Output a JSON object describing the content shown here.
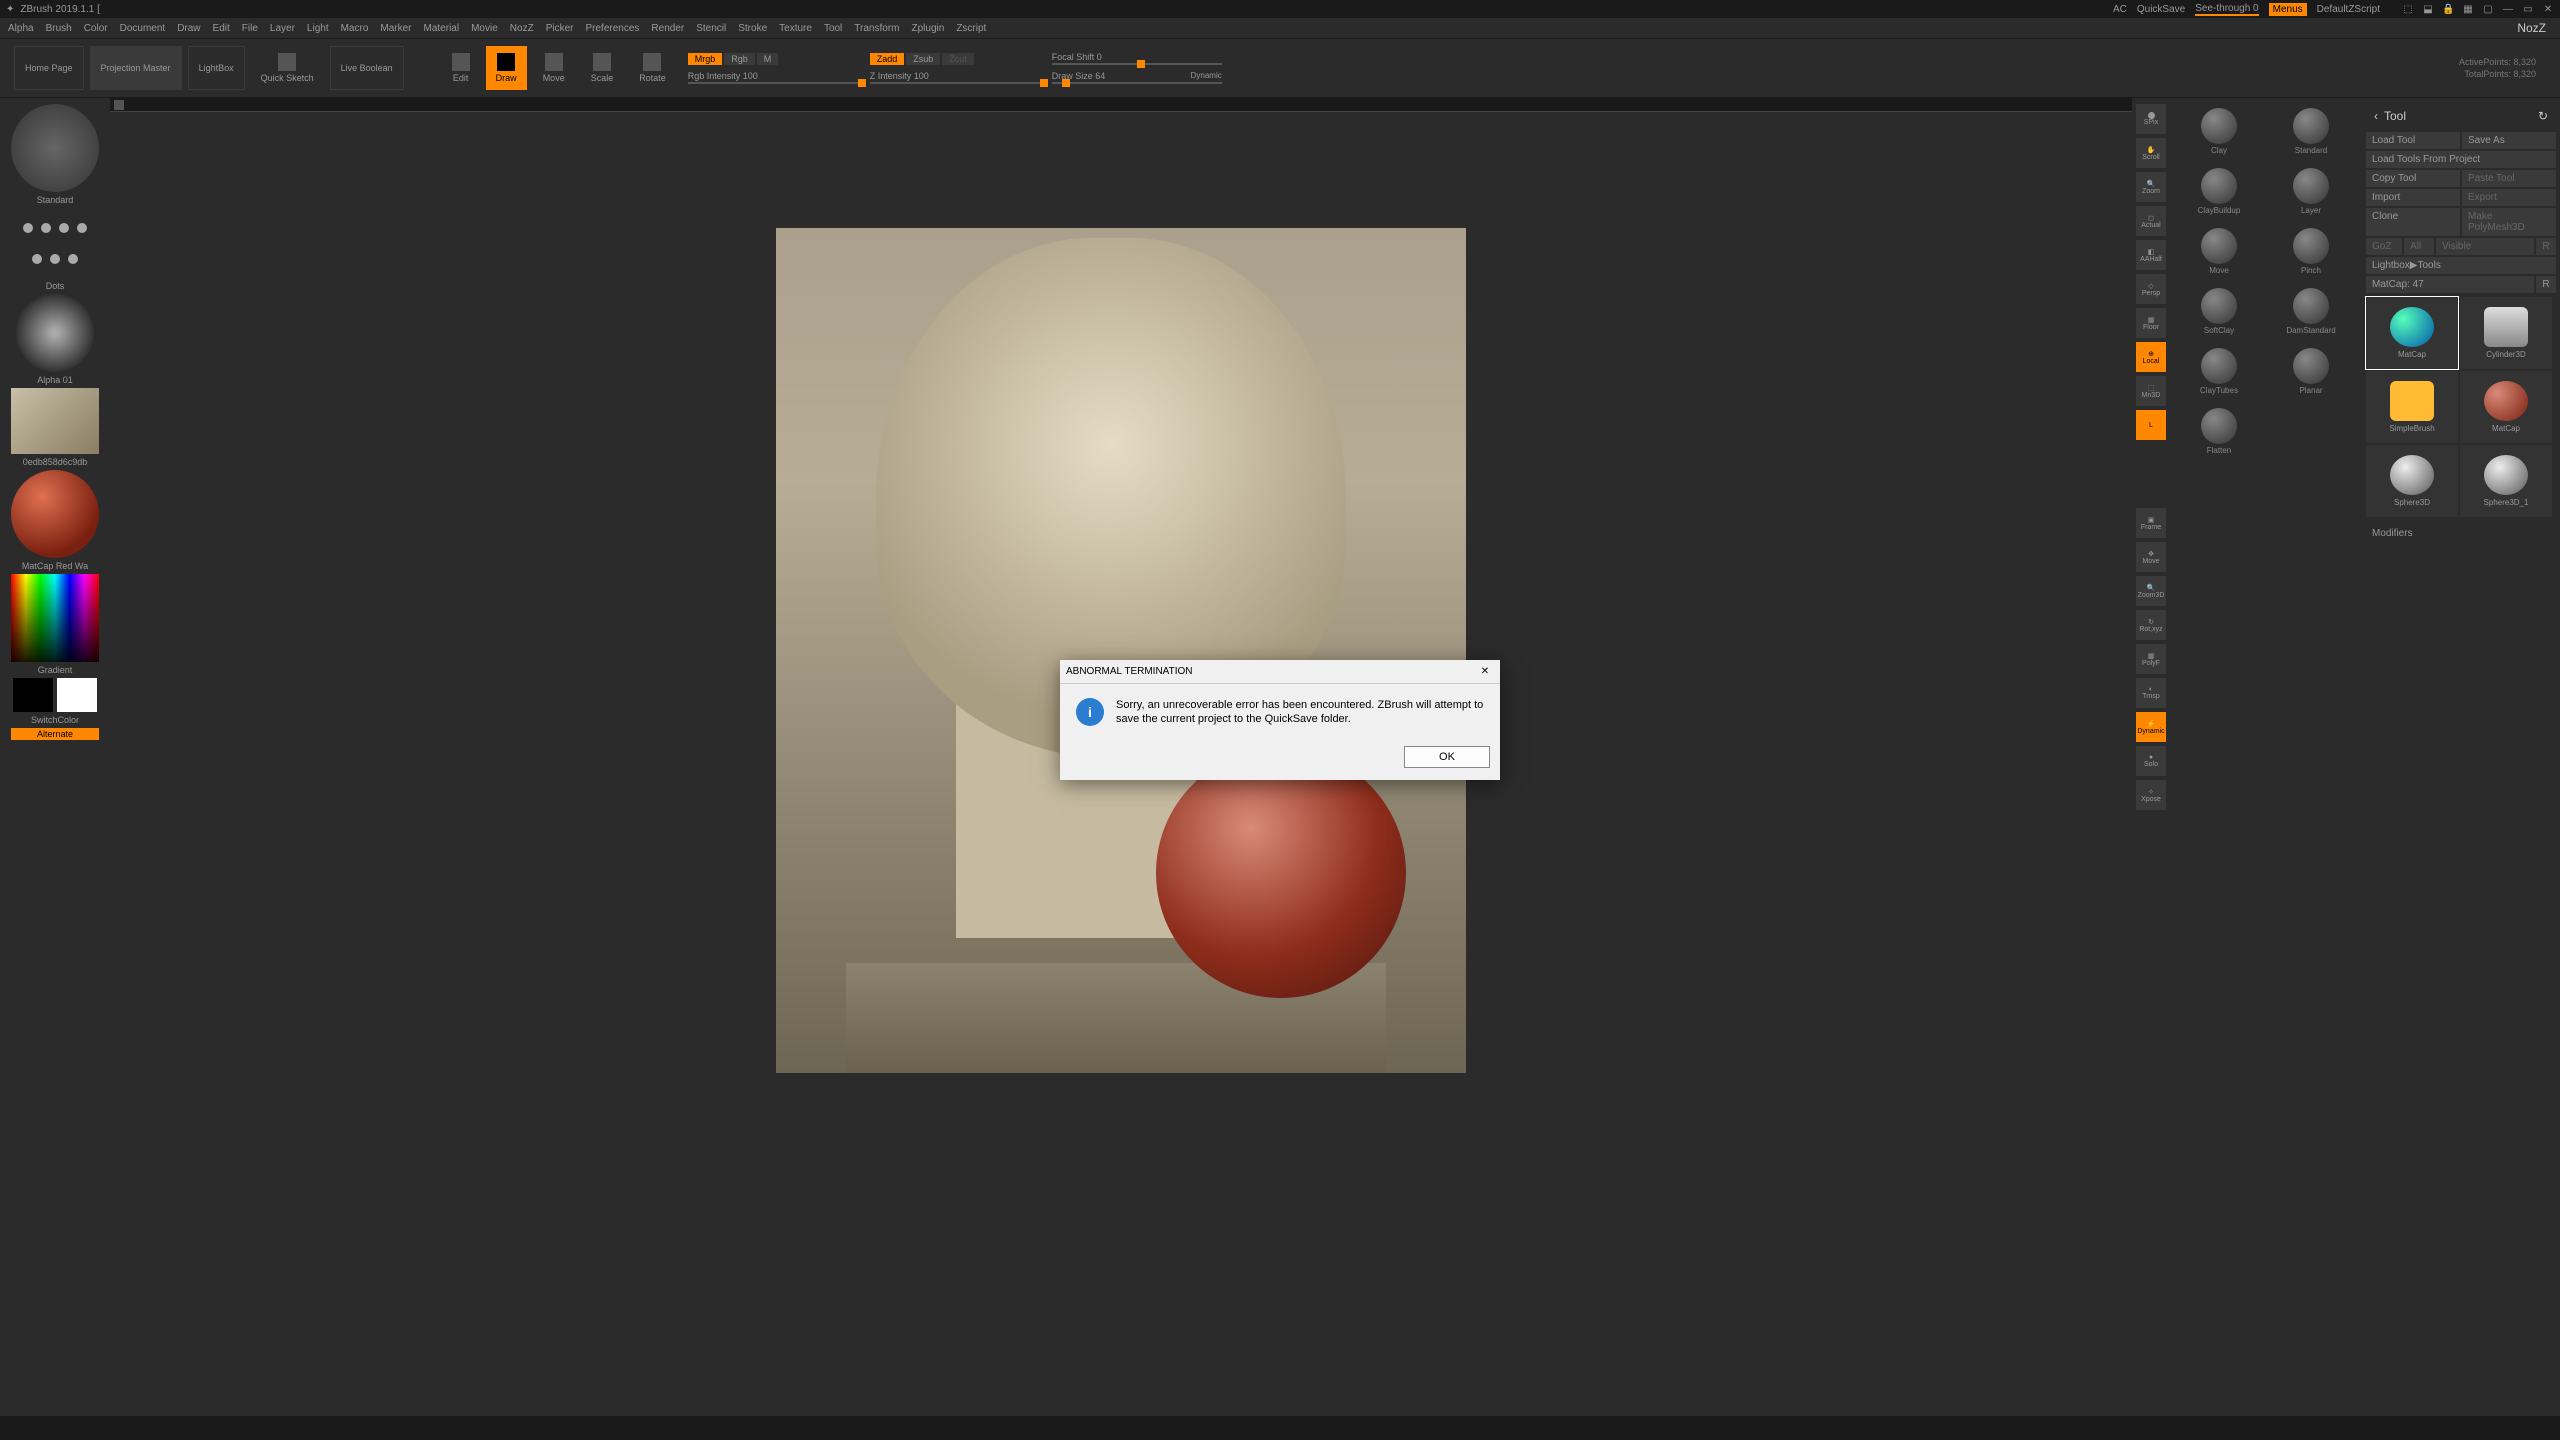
{
  "title": "ZBrush 2019.1.1 [",
  "header_right": {
    "ac": "AC",
    "quicksave": "QuickSave",
    "seethrough": "See-through  0",
    "menus": "Menus",
    "default_script": "DefaultZScript"
  },
  "project_label": "NozZ",
  "menu": [
    "Alpha",
    "Brush",
    "Color",
    "Document",
    "Draw",
    "Edit",
    "File",
    "Layer",
    "Light",
    "Macro",
    "Marker",
    "Material",
    "Movie",
    "NozZ",
    "Picker",
    "Preferences",
    "Render",
    "Stencil",
    "Stroke",
    "Texture",
    "Tool",
    "Transform",
    "Zplugin",
    "Zscript"
  ],
  "shelf": {
    "home": "Home Page",
    "proj_master": "Projection Master",
    "lightbox": "LightBox",
    "quicksketch": "Quick Sketch",
    "liveboolean": "Live Boolean",
    "edit": "Edit",
    "draw": "Draw",
    "move": "Move",
    "scale": "Scale",
    "rotate": "Rotate"
  },
  "topbar": {
    "mrgb": "Mrgb",
    "rgb": "Rgb",
    "m": "M",
    "zadd": "Zadd",
    "zsub": "Zsub",
    "zcut": "Zcut",
    "rgb_intensity_label": "Rgb Intensity",
    "rgb_intensity": "100",
    "z_intensity_label": "Z Intensity",
    "z_intensity": "100",
    "focal_label": "Focal Shift",
    "focal": "0",
    "draw_size_label": "Draw Size",
    "draw_size": "64",
    "dynamic": "Dynamic",
    "active_points_label": "ActivePoints:",
    "active_points": "8,320",
    "total_points_label": "TotalPoints:",
    "total_points": "8,320"
  },
  "left": {
    "brush": "Standard",
    "stroke": "Dots",
    "alpha": "Alpha 01",
    "texture_name": "0edb858d6c9db",
    "material": "MatCap Red Wa",
    "gradient": "Gradient",
    "switchcolor": "SwitchColor",
    "alternate": "Alternate"
  },
  "right_strip": [
    "SPix",
    "Scroll",
    "Zoom",
    "Actual",
    "AAHalf",
    "Persp",
    "Floor",
    "Local",
    "Mn3D",
    "Frame",
    "Move",
    "Zoom3D",
    "Rot,xyz",
    "PolyF",
    "Trnsp",
    "Dynamic",
    "Solo",
    "Xpose"
  ],
  "right_strip_orange": [
    8,
    17
  ],
  "brush_grid": [
    "Clay",
    "Standard",
    "ClayBuildup",
    "Layer",
    "Move",
    "Pinch",
    "SoftClay",
    "DamStandard",
    "ClayTubes",
    "Planar",
    "Flatten"
  ],
  "tool_panel": {
    "title": "Tool",
    "load": "Load Tool",
    "saveas": "Save As",
    "load_from": "Load Tools From Project",
    "copy": "Copy Tool",
    "paste": "Paste Tool",
    "import": "Import",
    "export": "Export",
    "clone": "Clone",
    "makepm3d": "Make PolyMesh3D",
    "goz": "GoZ",
    "all": "All",
    "visible": "Visible",
    "R": "R",
    "lightbox_tools": "Lightbox▶Tools",
    "matcap_label": "MatCap: 47",
    "matcap_r": "R",
    "grid": [
      "MatCap",
      "Cylinder3D",
      "SimpleBrush",
      "MatCap",
      "Sphere3D",
      "Sphere3D_1"
    ],
    "modifiers": "Modifiers"
  },
  "dialog": {
    "title": "ABNORMAL TERMINATION",
    "body": "Sorry, an unrecoverable error has been encountered. ZBrush will attempt to save the current project to the QuickSave folder.",
    "ok": "OK"
  }
}
